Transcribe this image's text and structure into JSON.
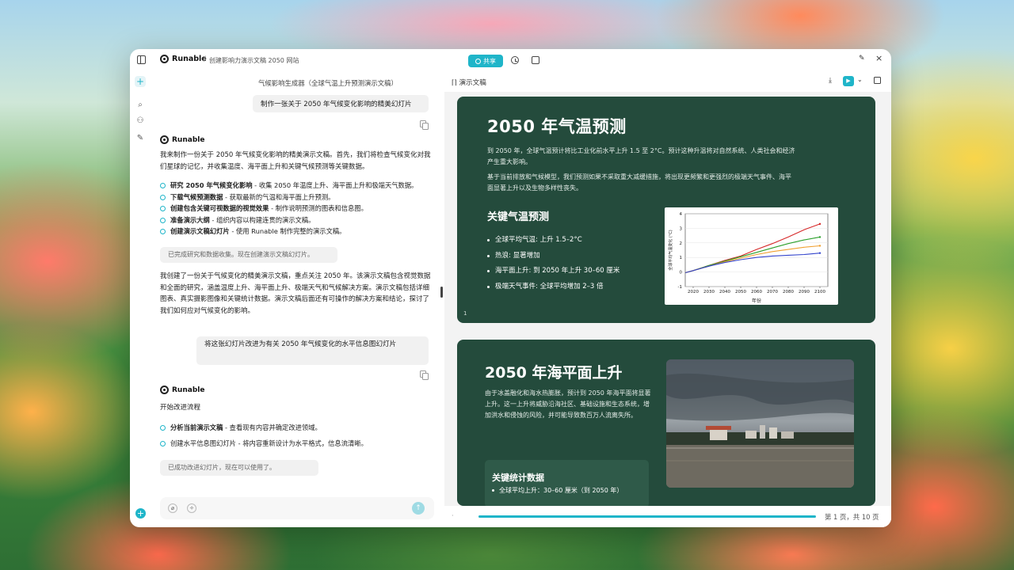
{
  "app": {
    "brand": "Runable",
    "breadcrumb_sep": "/",
    "doc_title": "创建影响力演示文稿 2050 网站",
    "share_label": "共享"
  },
  "chat": {
    "system_title": "气候影响生成器（全球气温上升预测演示文稿）",
    "user_msg_1": "制作一张关于 2050 年气候变化影响的精美幻灯片",
    "agent_name": "Runable",
    "agent_intro": "我来制作一份关于 2050 年气候变化影响的精美演示文稿。首先，我们将检查气候变化对我们星球的记忆，并收集温度、海平面上升和关键气候预测等关键数据。",
    "steps_1": [
      {
        "bold": "研究 2050 年气候变化影响",
        "rest": " - 收集 2050 年温度上升、海平面上升和极端天气数据。"
      },
      {
        "bold": "下载气候预测数据",
        "rest": " - 获取最新的气温和海平面上升预测。"
      },
      {
        "bold": "创建包含关键可视数据的视觉效果",
        "rest": " - 制作说明预测的图表和信息图。"
      },
      {
        "bold": "准备演示大纲",
        "rest": " - 组织内容以构建连贯的演示文稿。"
      },
      {
        "bold": "创建演示文稿幻灯片",
        "rest": " - 使用 Runable 制作完整的演示文稿。"
      }
    ],
    "status_1": "已完成研究和数据收集。现在创建演示文稿幻灯片。",
    "agent_summary": "我创建了一份关于气候变化的精美演示文稿，重点关注 2050 年。该演示文稿包含视觉数据和全面的研究，涵盖温度上升、海平面上升、极端天气和气候解决方案。演示文稿包括详细图表、真实摄影图像和关键统计数据。演示文稿后面还有可操作的解决方案和结论，探讨了我们如何应对气候变化的影响。",
    "user_msg_2": "将这张幻灯片改进为有关 2050 年气候变化的水平信息图幻灯片",
    "agent_name_2": "Runable",
    "agent_start": "开始改进流程",
    "steps_2": [
      {
        "bold": "分析当前演示文稿",
        "rest": " - 查看现有内容并确定改进领域。"
      },
      {
        "bold": "",
        "rest": "创建水平信息图幻灯片 - 将内容重新设计为水平格式，信息流清晰。"
      }
    ],
    "status_2": "已成功改进幻灯片，现在可以使用了。"
  },
  "slides_panel": {
    "title": "演示文稿",
    "page_indicator": "第 1 页，共 10 页"
  },
  "slide1": {
    "title": "2050 年气温预测",
    "para1": "到 2050 年，全球气温预计将比工业化前水平上升 1.5 至 2°C。预计这种升温将对自然系统、人类社会和经济产生重大影响。",
    "para2": "基于当前排放和气候模型，我们预测如果不采取重大减缓措施，将出现更频繁和更强烈的极端天气事件、海平面显著上升以及生物多样性丧失。",
    "subheading": "关键气温预测",
    "bullets": [
      "全球平均气温: 上升 1.5–2°C",
      "热浪: 显著增加",
      "海平面上升: 到 2050 年上升 30–60 厘米",
      "极端天气事件: 全球平均增加 2–3 倍"
    ],
    "slide_number": "1"
  },
  "chart_data": {
    "type": "line",
    "title": "",
    "xlabel": "年份",
    "ylabel": "全球平均气温变化 (°C)",
    "xlim": [
      2015,
      2105
    ],
    "ylim": [
      -1,
      4
    ],
    "x_ticks": [
      "2020",
      "2030",
      "2040",
      "2050",
      "2060",
      "2070",
      "2080",
      "2090",
      "2100"
    ],
    "y_ticks": [
      "-1",
      "0",
      "1",
      "2",
      "3",
      "4"
    ],
    "x": [
      2015,
      2020,
      2030,
      2040,
      2050,
      2060,
      2070,
      2080,
      2090,
      2100
    ],
    "series": [
      {
        "values": [
          -0.05,
          0.1,
          0.45,
          0.8,
          1.1,
          1.55,
          1.95,
          2.4,
          2.9,
          3.3
        ],
        "color": "#d62728"
      },
      {
        "values": [
          -0.05,
          0.1,
          0.45,
          0.75,
          1.05,
          1.35,
          1.65,
          1.95,
          2.2,
          2.4
        ],
        "color": "#2ca02c"
      },
      {
        "values": [
          -0.05,
          0.1,
          0.4,
          0.7,
          0.95,
          1.2,
          1.4,
          1.55,
          1.7,
          1.8
        ],
        "color": "#f0a030"
      },
      {
        "values": [
          -0.05,
          0.1,
          0.4,
          0.65,
          0.85,
          1.0,
          1.1,
          1.15,
          1.2,
          1.3
        ],
        "color": "#3344cc"
      }
    ],
    "grid": true
  },
  "slide2": {
    "title": "2050 年海平面上升",
    "para": "由于冰盖融化和海水热膨胀，预计到 2050 年海平面将显著上升。这一上升将威胁沿海社区、基础设施和生态系统，增加洪水和侵蚀的风险，并可能导致数百万人流离失所。",
    "card_title": "关键统计数据",
    "card_bullet": "全球平均上升：30–60 厘米（到 2050 年）"
  }
}
